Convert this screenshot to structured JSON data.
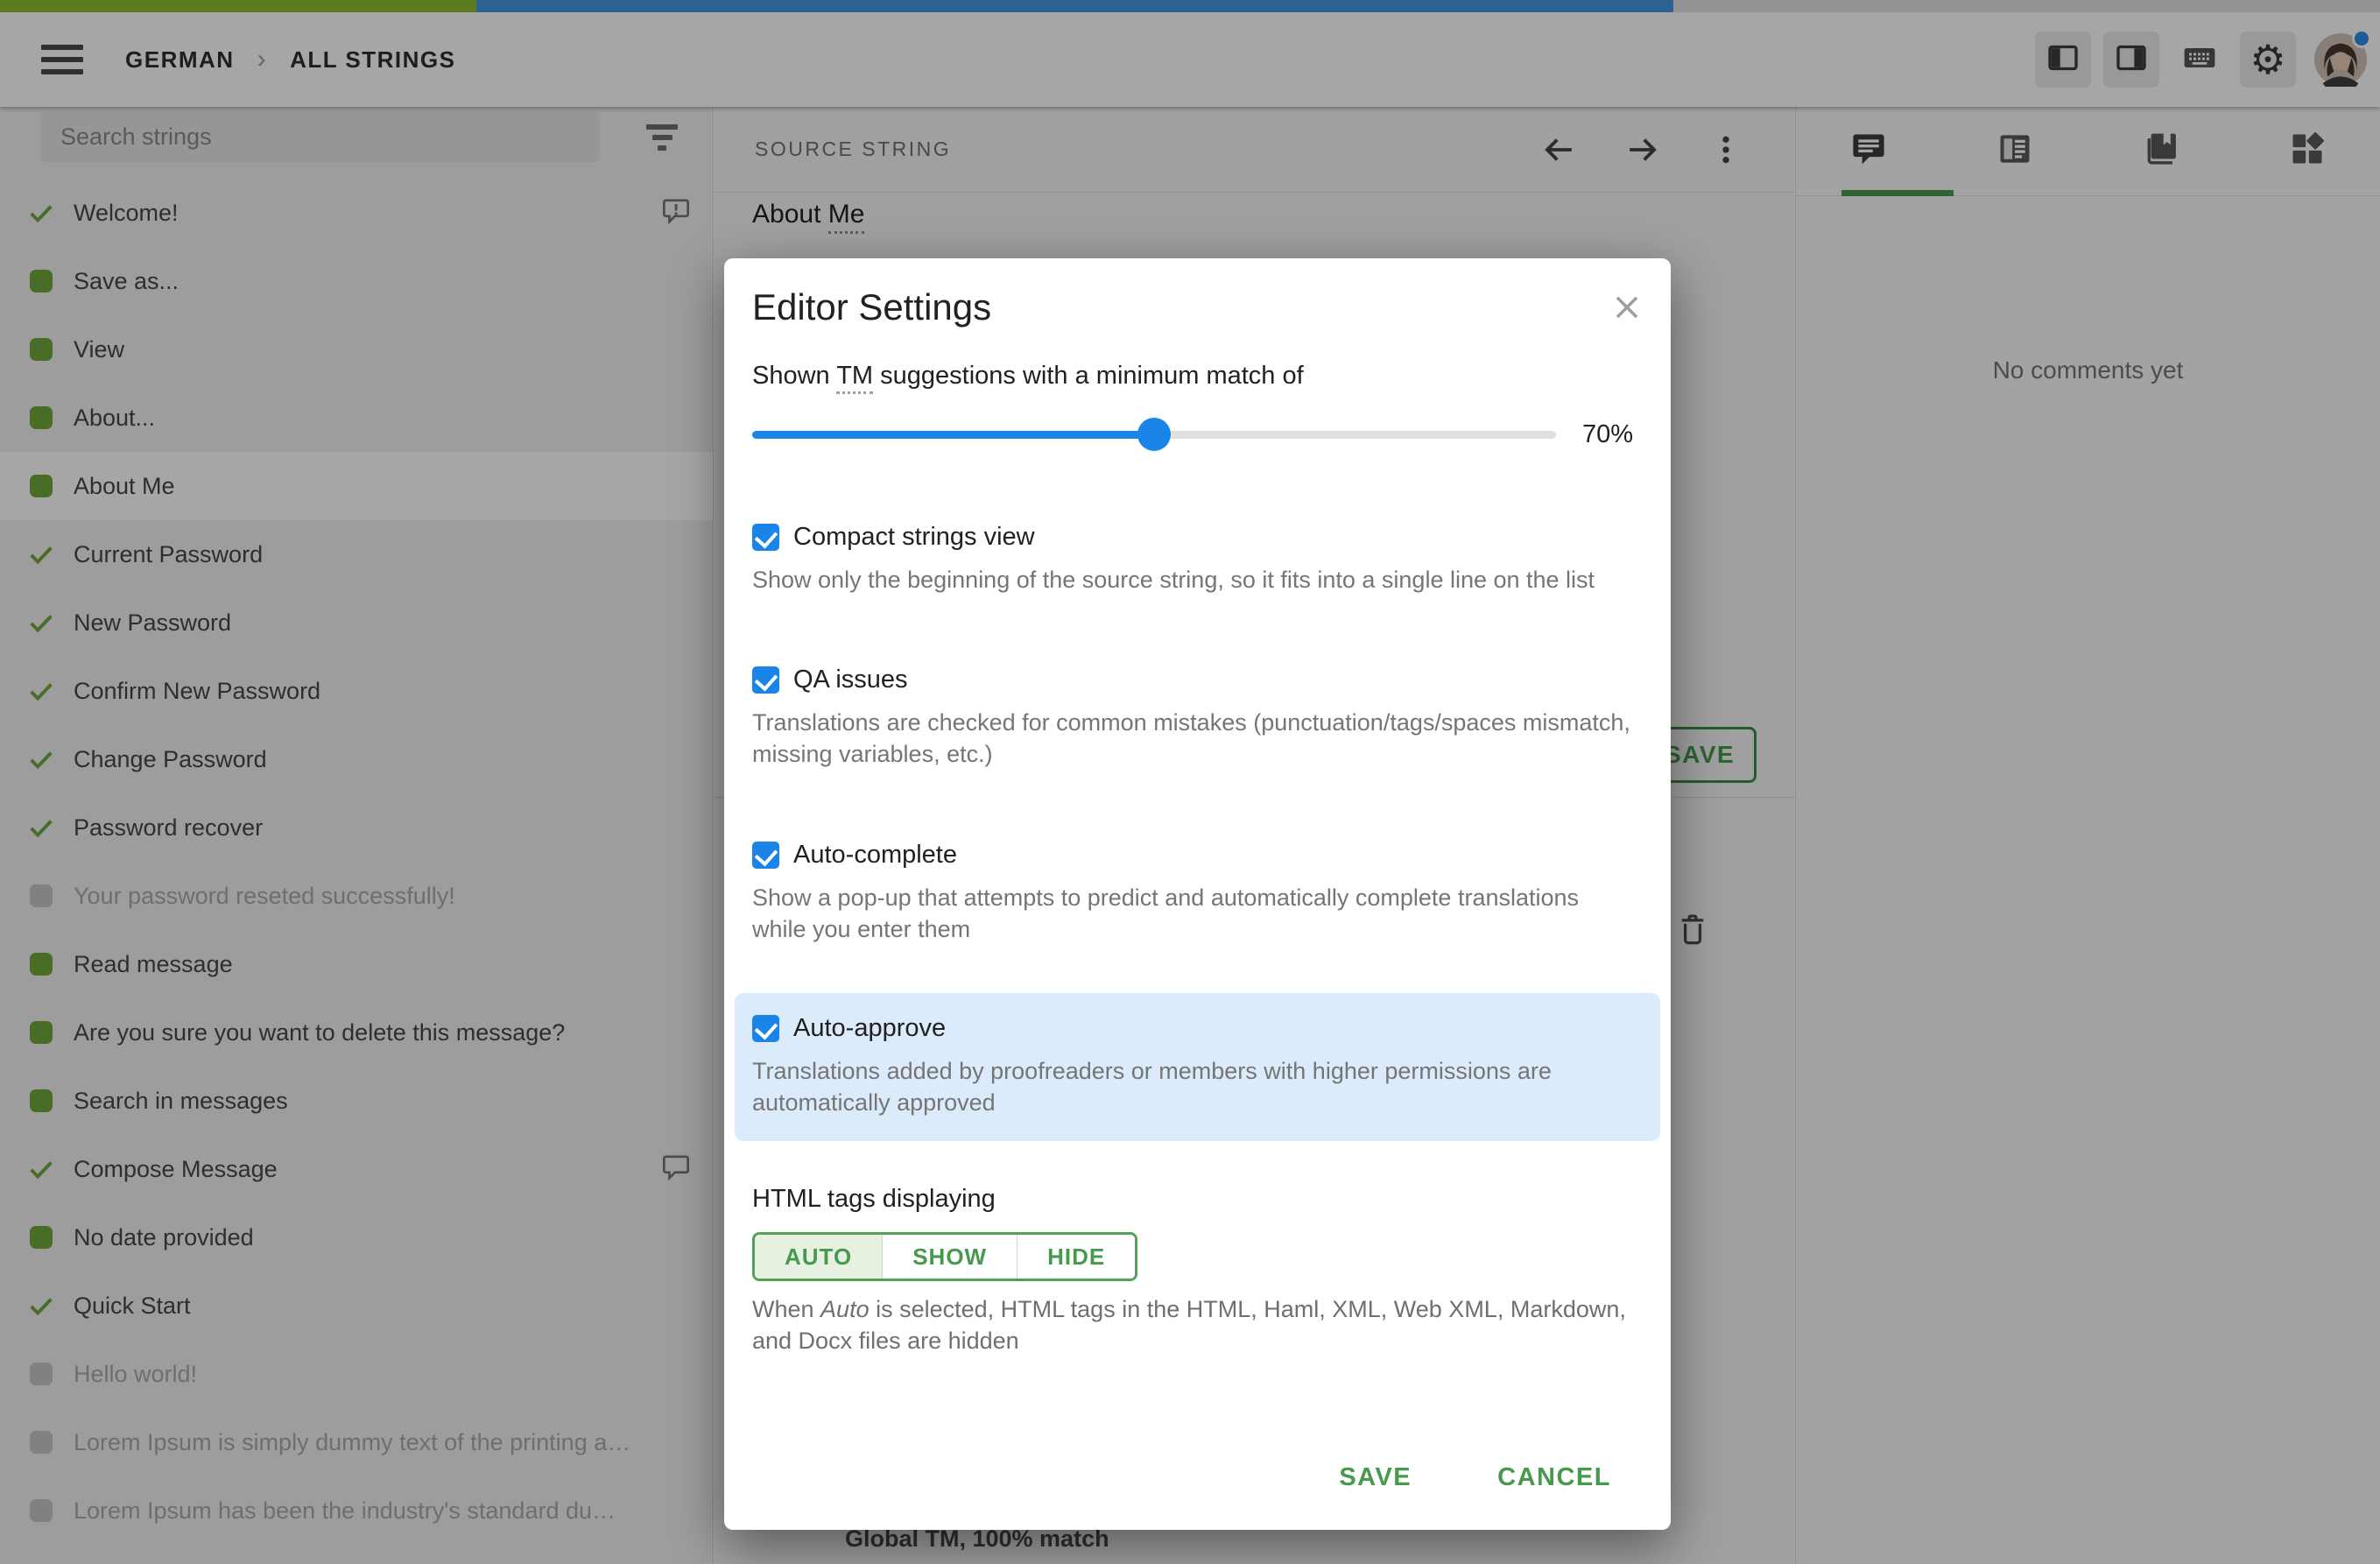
{
  "top_progress": {
    "approved_pct": 20.0,
    "translated_pct": 50.3
  },
  "topbar": {
    "breadcrumb": {
      "project": "GERMAN",
      "section": "ALL STRINGS"
    },
    "icons": [
      "menu-icon",
      "panel-left-icon",
      "panel-right-icon",
      "keyboard-icon",
      "settings-gear-icon",
      "avatar"
    ]
  },
  "sidebar": {
    "search_placeholder": "Search strings",
    "items": [
      {
        "label": "Welcome!",
        "status": "approved",
        "comment": "exclaim",
        "selected": false
      },
      {
        "label": "Save as...",
        "status": "translated",
        "comment": null,
        "selected": false
      },
      {
        "label": "View",
        "status": "translated",
        "comment": null,
        "selected": false
      },
      {
        "label": "About...",
        "status": "translated",
        "comment": null,
        "selected": false
      },
      {
        "label": "About Me",
        "status": "translated",
        "comment": null,
        "selected": true
      },
      {
        "label": "Current Password",
        "status": "approved",
        "comment": null,
        "selected": false
      },
      {
        "label": "New Password",
        "status": "approved",
        "comment": null,
        "selected": false
      },
      {
        "label": "Confirm New Password",
        "status": "approved",
        "comment": null,
        "selected": false
      },
      {
        "label": "Change Password",
        "status": "approved",
        "comment": null,
        "selected": false
      },
      {
        "label": "Password recover",
        "status": "approved",
        "comment": null,
        "selected": false
      },
      {
        "label": "Your password reseted successfully!",
        "status": "untranslated",
        "comment": null,
        "selected": false
      },
      {
        "label": "Read message",
        "status": "translated",
        "comment": null,
        "selected": false
      },
      {
        "label": "Are you sure you want to delete this message?",
        "status": "translated",
        "comment": null,
        "selected": false
      },
      {
        "label": "Search in messages",
        "status": "translated",
        "comment": null,
        "selected": false
      },
      {
        "label": "Compose Message",
        "status": "approved",
        "comment": "plain",
        "selected": false
      },
      {
        "label": "No date provided",
        "status": "translated",
        "comment": null,
        "selected": false
      },
      {
        "label": "Quick Start",
        "status": "approved",
        "comment": null,
        "selected": false
      },
      {
        "label": "Hello world!",
        "status": "untranslated",
        "comment": null,
        "selected": false
      },
      {
        "label": "Lorem Ipsum is simply dummy text of the printing and ty…",
        "status": "untranslated",
        "comment": null,
        "selected": false
      },
      {
        "label": "Lorem Ipsum has been the industry's standard dummy t…",
        "status": "untranslated",
        "comment": null,
        "selected": false
      }
    ]
  },
  "editor": {
    "column_header": "SOURCE STRING",
    "source_string_prefix": "About ",
    "source_string_term": "Me",
    "save_button": "SAVE",
    "tm_match": "Global TM, 100% match"
  },
  "comments_panel": {
    "empty_message": "No comments yet"
  },
  "modal": {
    "title": "Editor Settings",
    "tm_row": {
      "prefix": "Shown ",
      "term": "TM",
      "suffix": " suggestions with a minimum match of",
      "value": "70%",
      "slider_pct": 50
    },
    "options": [
      {
        "label": "Compact strings view",
        "checked": true,
        "highlight": false,
        "desc": "Show only the beginning of the source string, so it fits into a single line on the list"
      },
      {
        "label": "QA issues",
        "checked": true,
        "highlight": false,
        "desc": "Translations are checked for common mistakes (punctuation/tags/spaces mismatch, missing variables, etc.)"
      },
      {
        "label": "Auto-complete",
        "checked": true,
        "highlight": false,
        "desc": "Show a pop-up that attempts to predict and automatically complete translations while you enter them"
      },
      {
        "label": "Auto-approve",
        "checked": true,
        "highlight": true,
        "desc": "Translations added by proofreaders or members with higher permissions are automatically approved"
      }
    ],
    "html_tags": {
      "label": "HTML tags displaying",
      "options": [
        "AUTO",
        "SHOW",
        "HIDE"
      ],
      "selected": "AUTO",
      "note_prefix": "When ",
      "note_em": "Auto",
      "note_suffix": " is selected, HTML tags in the HTML, Haml, XML, Web XML, Markdown, and Docx files are hidden"
    },
    "buttons": {
      "save": "SAVE",
      "cancel": "CANCEL"
    },
    "colors": {
      "accent_blue": "#1a84e8",
      "accent_green": "#47994d",
      "highlight_bg": "#dcebfb"
    }
  }
}
